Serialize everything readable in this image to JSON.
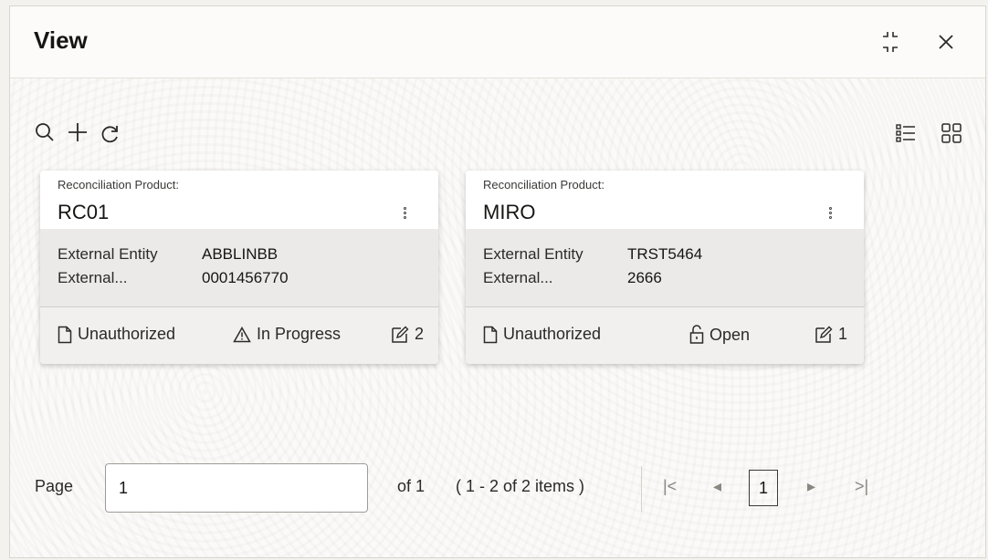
{
  "dialog": {
    "title": "View"
  },
  "header_icons": {
    "collapse": "collapse-icon",
    "close": "close-icon"
  },
  "toolbar": {
    "icons": [
      "search-icon",
      "add-icon",
      "refresh-icon",
      "list-view-icon",
      "grid-view-icon"
    ]
  },
  "cards": [
    {
      "label": "Reconciliation Product:",
      "value": "RC01",
      "fields": [
        {
          "key": "External Entity",
          "value": "ABBLINBB"
        },
        {
          "key": "External...",
          "value": "0001456770"
        }
      ],
      "status": "Unauthorized",
      "state": "In Progress",
      "modifications": "2"
    },
    {
      "label": "Reconciliation Product:",
      "value": "MIRO",
      "fields": [
        {
          "key": "External Entity",
          "value": "TRST5464"
        },
        {
          "key": "External...",
          "value": "2666"
        }
      ],
      "status": "Unauthorized",
      "state": "Open",
      "modifications": "1"
    }
  ],
  "pagination": {
    "page_label": "Page",
    "page_value": "1",
    "of_total": "of 1",
    "items_summary": "( 1 - 2 of 2 items )",
    "current_page": "1",
    "first": "|<",
    "prev": "◂",
    "next": "▸",
    "last": ">|"
  }
}
